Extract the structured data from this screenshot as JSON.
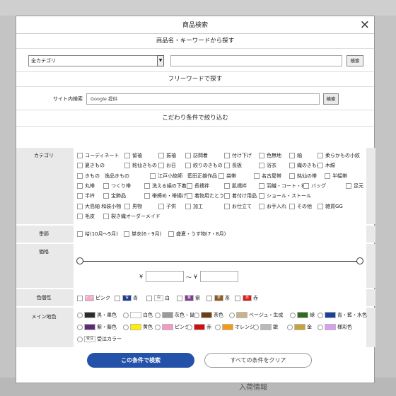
{
  "modal": {
    "title": "商品検索",
    "close_label": "×"
  },
  "keyword_section": {
    "heading": "商品名・キーワードから探す",
    "category_select": "全カテゴリ",
    "search_label": "検索"
  },
  "freeword_section": {
    "heading": "フリーワードで探す",
    "site_search_label": "サイト内検索",
    "google_text": "Google 提供",
    "search_label": "検索"
  },
  "filter_section": {
    "heading": "こだわり条件で絞り込む"
  },
  "category": {
    "label": "カテゴリ",
    "rows": [
      [
        "コーディネート",
        "留袖",
        "振袖",
        "訪問着",
        "付け下げ",
        "色無地",
        "紬",
        "柔らかもの小紋"
      ],
      [
        "夏きもの",
        "銘仙きもの",
        "お召",
        "絞りのきもの",
        "長板",
        "浴衣",
        "織のきもの",
        "木綿"
      ],
      [
        "きもの　逸品きもの",
        "江戸小紋師　藍田正雄作品",
        "袋帯",
        "名古屋帯",
        "銘仙の帯",
        "半幅帯"
      ],
      [
        "丸帯",
        "つくり帯",
        "洗える絹の下着",
        "長襦袢",
        "肌襦袢",
        "羽織・コート・袴",
        "バッグ",
        "足元"
      ],
      [
        "半衿",
        "宝飾品",
        "帯締め・帯揚げ",
        "着物用たとう紙",
        "着付け用品",
        "ショール・ストール"
      ],
      [
        "大島紬 和装小物",
        "男物",
        "子供",
        "加工",
        "お仕立て",
        "お手入れ",
        "その他",
        "雑貨GG"
      ],
      [
        "毛皮",
        "裂き織オーダーメイド"
      ]
    ]
  },
  "season": {
    "label": "季節",
    "options": [
      "袷(10月〜5月)",
      "単衣(6・9月)",
      "盛夏・うす物(7・8月)"
    ]
  },
  "price": {
    "label": "価格",
    "currency": "¥",
    "separator": "〜"
  },
  "color_property": {
    "label": "色個性",
    "options": [
      {
        "text": "ピンク",
        "swatch": "ピンク",
        "color": "#f3a6c8",
        "tc": "#fff"
      },
      {
        "text": "青",
        "swatch": "青",
        "color": "#1d3f93",
        "tc": "#fff"
      },
      {
        "text": "白",
        "swatch": "白",
        "color": "#ffffff",
        "tc": "#333"
      },
      {
        "text": "紫",
        "swatch": "紫",
        "color": "#7e3d8f",
        "tc": "#fff"
      },
      {
        "text": "茶",
        "swatch": "茶",
        "color": "#8a5a1e",
        "tc": "#fff"
      },
      {
        "text": "赤",
        "swatch": "赤",
        "color": "#d91c1c",
        "tc": "#fff"
      }
    ]
  },
  "main_color": {
    "label": "メイン地色",
    "rows": [
      [
        {
          "text": "黒・墨色",
          "color": "#2b2b2b"
        },
        {
          "text": "白色",
          "color": "#ffffff"
        },
        {
          "text": "灰色・鼠",
          "color": "#9a9a9a"
        },
        {
          "text": "茶色",
          "color": "#6b3f12"
        },
        {
          "text": "ベージュ・生成",
          "color": "#c9b38a"
        },
        {
          "text": "緑",
          "color": "#2f6b1a"
        },
        {
          "text": "青・藍・水色",
          "color": "#1f3f99"
        }
      ],
      [
        {
          "text": "紫・藤色",
          "color": "#5e2a73"
        },
        {
          "text": "黄色",
          "color": "#ffee00"
        },
        {
          "text": "ピンク",
          "color": "#f39ac0"
        },
        {
          "text": "赤",
          "color": "#cf0f0f"
        },
        {
          "text": "オレンジ",
          "color": "#f59a12"
        },
        {
          "text": "銀",
          "color": "#b9b9b9"
        },
        {
          "text": "金",
          "color": "#c8a23e"
        },
        {
          "text": "様彩色",
          "color": "#d89ef0"
        }
      ],
      [
        {
          "text": "受注カラー",
          "color": "#ffffff",
          "swatch": "受注"
        }
      ]
    ]
  },
  "actions": {
    "search": "この条件で検索",
    "clear": "すべての条件をクリア"
  },
  "background": {
    "bottom_text": "入荷情報"
  }
}
